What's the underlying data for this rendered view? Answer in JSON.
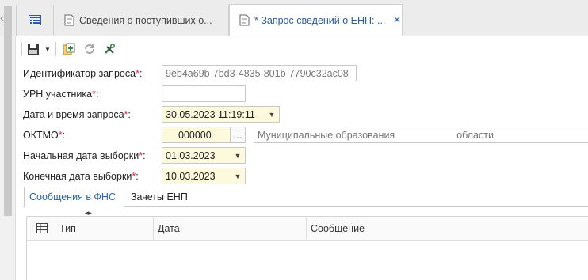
{
  "tabs": [
    {
      "label": "",
      "icon": "list-icon"
    },
    {
      "label": "Сведения о поступивших о...",
      "icon": "document-icon"
    },
    {
      "label": "* Запрос сведений о ЕНП: ...",
      "icon": "document-icon",
      "active": true
    }
  ],
  "toolbar": {
    "buttons": [
      "save-icon",
      "dropdown-arrow-icon",
      "add-document-icon",
      "refresh-icon",
      "settings-tools-icon"
    ]
  },
  "form": {
    "request_id": {
      "label": "Идентификатор запроса",
      "value": "9eb4a69b-7bd3-4835-801b-7790c32ac08"
    },
    "urn": {
      "label": "УРН участника",
      "value": ""
    },
    "datetime": {
      "label": "Дата и время запроса",
      "value": "30.05.2023 11:19:11"
    },
    "oktmo": {
      "label": "ОКТМО",
      "value": "000000",
      "name_prefix": "Муниципальные образования",
      "name_suffix": "области"
    },
    "start_date": {
      "label": "Начальная дата выборки",
      "value": "01.03.2023"
    },
    "end_date": {
      "label": "Конечная дата выборки",
      "value": "10.03.2023"
    },
    "required_mark": "*",
    "colon": ":"
  },
  "subtabs": [
    "Сообщения в ФНС",
    "Зачеты ЕНП"
  ],
  "grid": {
    "columns": [
      "Тип",
      "Дата",
      "Сообщение"
    ]
  },
  "colors": {
    "accent": "#2b63b0",
    "required": "#dd2244",
    "field_yellow": "#fdf9dd"
  }
}
